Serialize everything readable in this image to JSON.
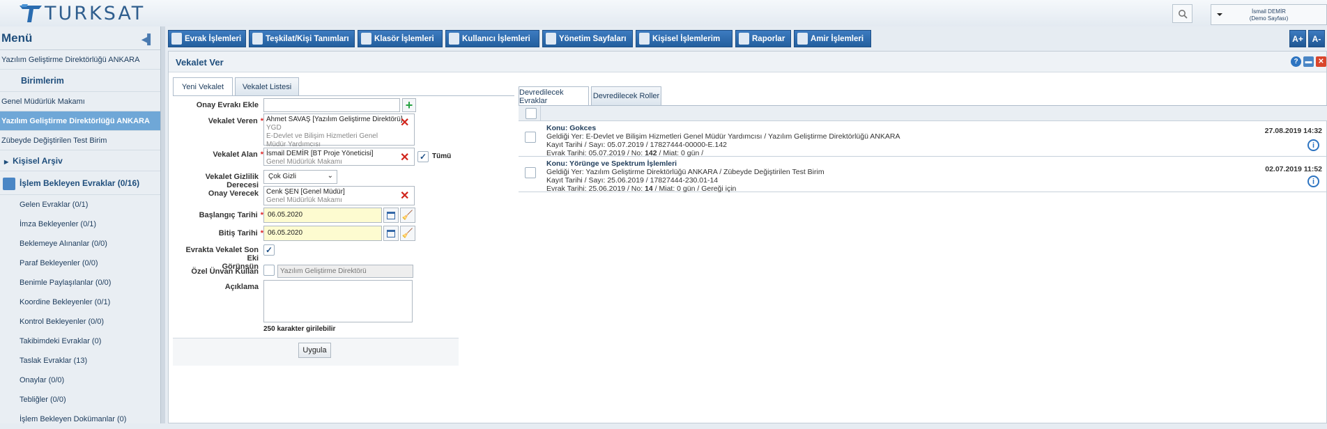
{
  "brand": {
    "logo_text": "TURKSAT"
  },
  "user": {
    "name": "İsmail DEMİR",
    "role": "(Demo Sayfası)"
  },
  "sidebar": {
    "menu_title": "Menü",
    "unit": "Yazılım Geliştirme Direktörlüğü ANKARA",
    "birimlerim": "Birimlerim",
    "units": [
      {
        "label": "Genel Müdürlük Makamı"
      },
      {
        "label": "Yazılım Geliştirme Direktörlüğü ANKARA"
      },
      {
        "label": "Zübeyde Değiştirilen Test Birim"
      }
    ],
    "kisisel_arsiv": "Kişisel Arşiv",
    "islem_bekleyen": "İşlem Bekleyen Evraklar (0/16)",
    "items": [
      {
        "label": "Gelen Evraklar (0/1)"
      },
      {
        "label": "İmza Bekleyenler (0/1)"
      },
      {
        "label": "Beklemeye Alınanlar (0/0)"
      },
      {
        "label": "Paraf Bekleyenler (0/0)"
      },
      {
        "label": "Benimle Paylaşılanlar (0/0)"
      },
      {
        "label": "Koordine Bekleyenler (0/1)"
      },
      {
        "label": "Kontrol Bekleyenler (0/0)"
      },
      {
        "label": "Takibimdeki Evraklar (0)"
      },
      {
        "label": "Taslak Evraklar (13)"
      },
      {
        "label": "Onaylar (0/0)"
      },
      {
        "label": "Tebliğler (0/0)"
      },
      {
        "label": "İşlem Bekleyen Dokümanlar (0)"
      }
    ]
  },
  "nav": [
    {
      "label": "Evrak İşlemleri"
    },
    {
      "label": "Teşkilat/Kişi Tanımları"
    },
    {
      "label": "Klasör İşlemleri"
    },
    {
      "label": "Kullanıcı İşlemleri"
    },
    {
      "label": "Yönetim Sayfaları"
    },
    {
      "label": "Kişisel İşlemlerim"
    },
    {
      "label": "Raporlar"
    },
    {
      "label": "Amir İşlemleri"
    }
  ],
  "font_controls": {
    "increase": "A+",
    "decrease": "A-"
  },
  "panel": {
    "title": "Vekalet Ver",
    "tabs": [
      {
        "label": "Yeni Vekalet"
      },
      {
        "label": "Vekalet Listesi"
      }
    ]
  },
  "form": {
    "onay_evraki_label": "Onay Evrakı Ekle",
    "vekalet_veren_label": "Vekalet Veren",
    "vekalet_veren": {
      "name": "Ahmet SAVAŞ [Yazılım Geliştirme Direktörü]",
      "line2": "YGD",
      "line3": "E-Devlet ve Bilişim Hizmetleri Genel Müdür Yardımcısı"
    },
    "vekalet_alan_label": "Vekalet Alan",
    "vekalet_alan": {
      "name": "İsmail DEMİR [BT Proje Yöneticisi]",
      "line2": "Genel Müdürlük Makamı"
    },
    "tumu_label": "Tümü",
    "gizlilik_label": "Vekalet Gizlilik Derecesi",
    "gizlilik_value": "Çok Gizli",
    "onay_verecek_label": "Onay Verecek",
    "onay_verecek": {
      "name": "Cenk ŞEN [Genel Müdür]",
      "line2": "Genel Müdürlük Makamı"
    },
    "baslangic_label": "Başlangıç Tarihi",
    "baslangic_value": "06.05.2020",
    "bitis_label": "Bitiş Tarihi",
    "bitis_value": "06.05.2020",
    "son_ek_label_1": "Evrakta Vekalet Son Eki",
    "son_ek_label_2": "Görünsün",
    "ozel_unvan_label": "Özel Ünvan Kullan",
    "ozel_unvan_placeholder": "Yazılım Geliştirme Direktörü",
    "aciklama_label": "Açıklama",
    "char_limit": "250 karakter girilebilir",
    "submit": "Uygula"
  },
  "right": {
    "tabs": [
      {
        "label": "Devredilecek Evraklar"
      },
      {
        "label": "Devredilecek Roller"
      }
    ],
    "items": [
      {
        "konu": "Konu: Gokces",
        "geldigi": "Geldiği Yer: E-Devlet ve Bilişim Hizmetleri Genel Müdür Yardımcısı / Yazılım Geliştirme Direktörlüğü ANKARA",
        "kayit": "Kayıt Tarihi / Sayı: 05.07.2019 / 17827444-00000-E.142",
        "evrak_prefix": "Evrak Tarihi: 05.07.2019 / No: ",
        "no": "142",
        "evrak_suffix": " / Miat: 0 gün /",
        "date": "27.08.2019 14:32"
      },
      {
        "konu": "Konu: Yörünge ve Spektrum İşlemleri",
        "geldigi": "Geldiği Yer: Yazılım Geliştirme Direktörlüğü ANKARA / Zübeyde Değiştirilen Test Birim",
        "kayit": "Kayıt Tarihi / Sayı: 25.06.2019 / 17827444-230.01-14",
        "evrak_prefix": "Evrak Tarihi: 25.06.2019 / No: ",
        "no": "14",
        "evrak_suffix": " / Miat: 0 gün / Gereği için",
        "date": "02.07.2019 11:52"
      }
    ]
  }
}
